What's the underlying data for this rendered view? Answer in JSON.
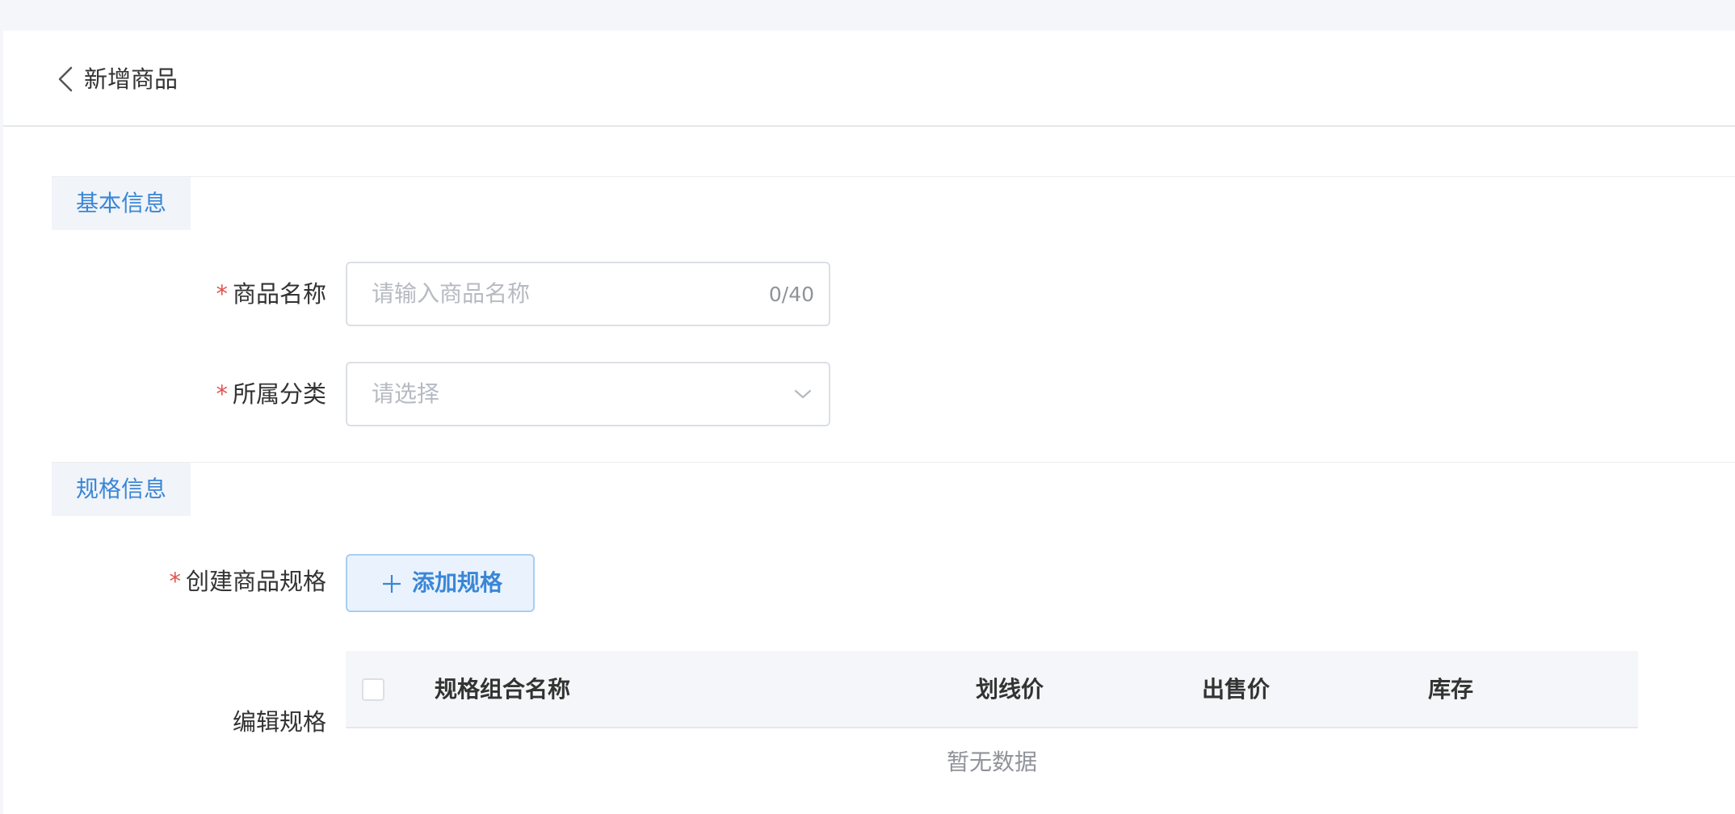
{
  "header": {
    "title": "新增商品"
  },
  "sections": {
    "basic": "基本信息",
    "spec": "规格信息"
  },
  "form": {
    "required_mark": "*",
    "name_label": "商品名称",
    "name_placeholder": "请输入商品名称",
    "name_counter": "0/40",
    "category_label": "所属分类",
    "category_placeholder": "请选择",
    "create_spec_label": "创建商品规格",
    "add_spec_button": "添加规格",
    "edit_spec_label": "编辑规格"
  },
  "table": {
    "columns": [
      "规格组合名称",
      "划线价",
      "出售价",
      "库存"
    ],
    "empty_text": "暂无数据"
  },
  "colors": {
    "accent": "#3a86d6",
    "required": "#e0534f",
    "placeholder": "#b6bac2"
  }
}
